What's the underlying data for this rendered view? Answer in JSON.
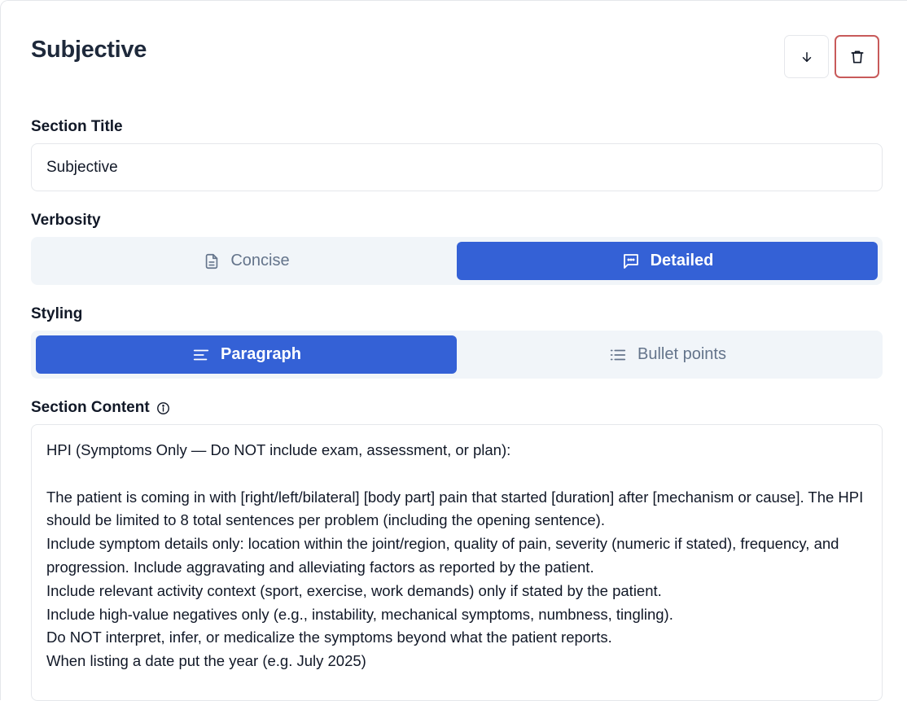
{
  "section": {
    "title": "Subjective"
  },
  "fields": {
    "section_title_label": "Section Title",
    "section_title_value": "Subjective",
    "verbosity_label": "Verbosity",
    "verbosity_options": [
      "Concise",
      "Detailed"
    ],
    "verbosity_selected": "Detailed",
    "styling_label": "Styling",
    "styling_options": [
      "Paragraph",
      "Bullet points"
    ],
    "styling_selected": "Paragraph",
    "content_label": "Section Content",
    "content_value": "HPI (Symptoms Only — Do NOT include exam, assessment, or plan):\n\nThe patient is coming in with [right/left/bilateral] [body part] pain that started [duration] after [mechanism or cause]. The HPI should be limited to 8 total sentences per problem (including the opening sentence).\nInclude symptom details only: location within the joint/region, quality of pain, severity (numeric if stated), frequency, and progression. Include aggravating and alleviating factors as reported by the patient.\nInclude relevant activity context (sport, exercise, work demands) only if stated by the patient.\nInclude high-value negatives only (e.g., instability, mechanical symptoms, numbness, tingling).\nDo NOT interpret, infer, or medicalize the symptoms beyond what the patient reports.\nWhen listing a date put the year (e.g. July 2025)"
  },
  "icons": {
    "move": "arrow-down-icon",
    "delete": "trash-icon",
    "concise": "document-icon",
    "detailed": "message-icon",
    "paragraph": "align-left-icon",
    "bullets": "list-icon",
    "info": "info-icon"
  },
  "colors": {
    "accent": "#3461d6",
    "delete_border": "#c85a5a",
    "segment_bg": "#f1f5f9",
    "muted_text": "#64748b"
  }
}
